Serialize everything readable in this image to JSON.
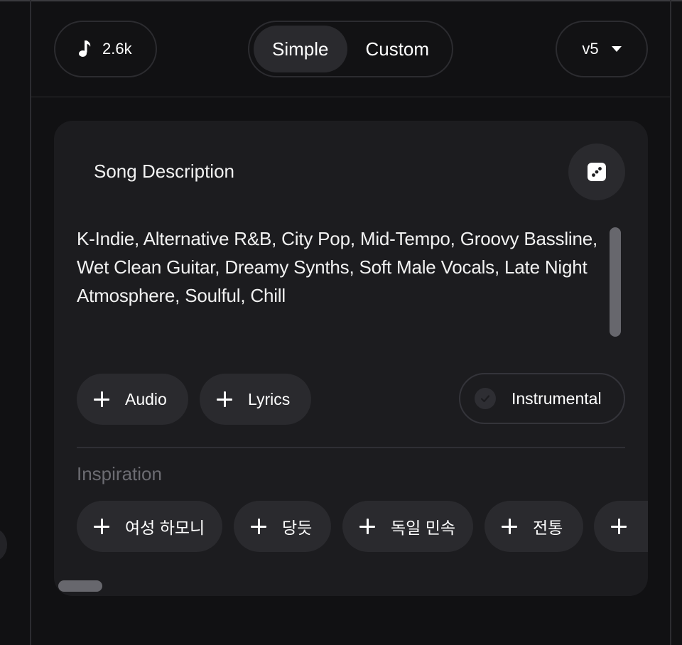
{
  "header": {
    "credits": "2.6k",
    "mode_tabs": [
      {
        "label": "Simple",
        "active": true
      },
      {
        "label": "Custom",
        "active": false
      }
    ],
    "version": "v5"
  },
  "card": {
    "title": "Song Description",
    "description": "K-Indie, Alternative R&B, City Pop, Mid-Tempo, Groovy Bassline, Wet Clean Guitar, Dreamy Synths, Soft Male Vocals, Late Night Atmosphere, Soulful, Chill",
    "actions": {
      "audio": "Audio",
      "lyrics": "Lyrics",
      "instrumental": "Instrumental"
    },
    "inspiration": {
      "label": "Inspiration",
      "chips": [
        "여성 하모니",
        "당듯",
        "독일 민속",
        "전통",
        ""
      ]
    }
  },
  "colors": {
    "background": "#111113",
    "card": "#1c1c1f",
    "chip": "#2a2a2e",
    "muted_text": "#6c6c72"
  },
  "icons": [
    "music-note-icon",
    "caret-down-icon",
    "dice-icon",
    "plus-icon",
    "check-icon"
  ]
}
